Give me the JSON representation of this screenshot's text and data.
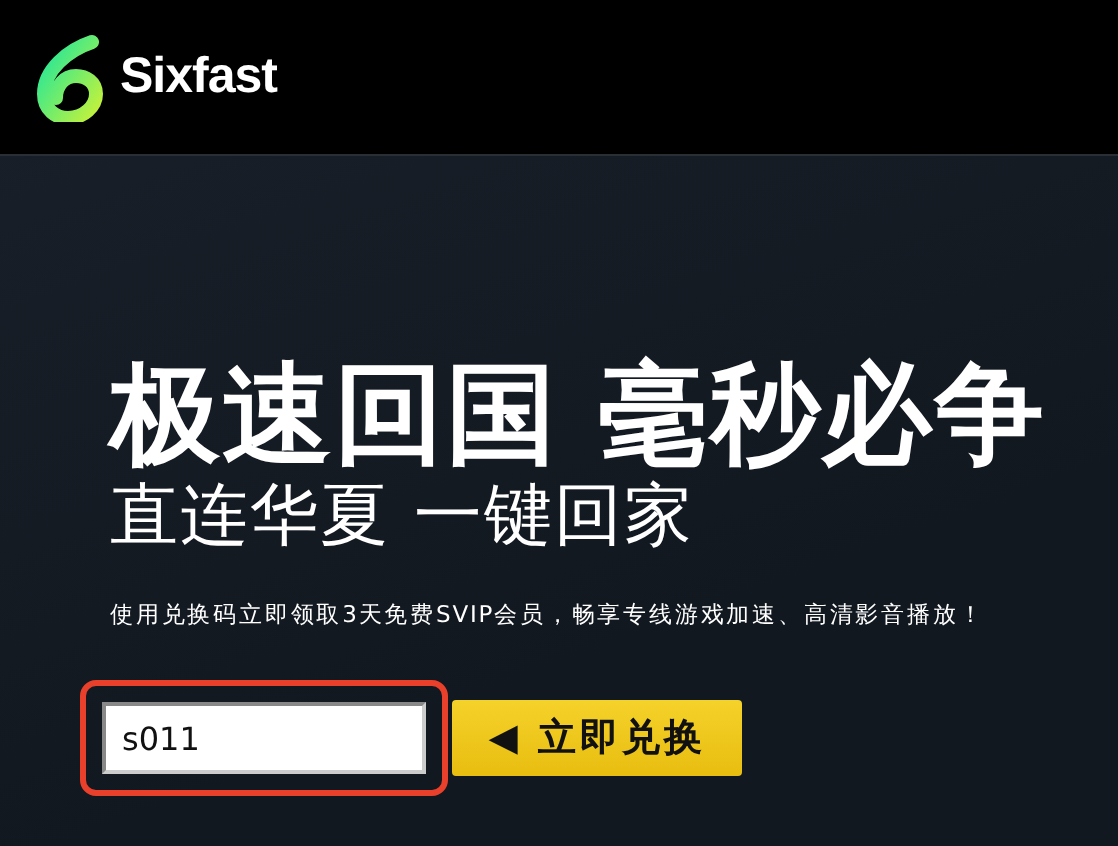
{
  "header": {
    "brand": "Sixfast"
  },
  "hero": {
    "headline": "极速回国 毫秒必争",
    "subheadline": "直连华夏 一键回家",
    "description": "使用兑换码立即领取3天免费SVIP会员，畅享专线游戏加速、高清影音播放！"
  },
  "redeem": {
    "code_field": {
      "value": "s011",
      "highlighted": true
    },
    "button": {
      "icon": "◀",
      "label": "立即兑换"
    }
  }
}
